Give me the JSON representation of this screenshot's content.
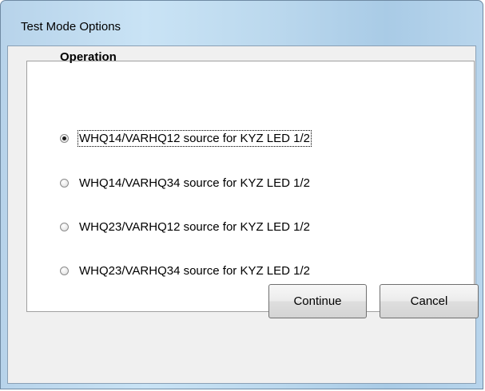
{
  "window": {
    "title": "Test Mode Options"
  },
  "group": {
    "label": "Operation",
    "options": [
      {
        "label": "WHQ14/VARHQ12 source for KYZ LED 1/2",
        "checked": true
      },
      {
        "label": "WHQ14/VARHQ34 source for KYZ LED 1/2",
        "checked": false
      },
      {
        "label": "WHQ23/VARHQ12 source for KYZ LED 1/2",
        "checked": false
      },
      {
        "label": "WHQ23/VARHQ34 source for KYZ LED 1/2",
        "checked": false
      }
    ]
  },
  "buttons": {
    "continue_label": "Continue",
    "cancel_label": "Cancel"
  },
  "colors": {
    "title_bar": "#c2dcf0",
    "client_bg": "#f0f0f0",
    "group_bg": "#ffffff"
  }
}
